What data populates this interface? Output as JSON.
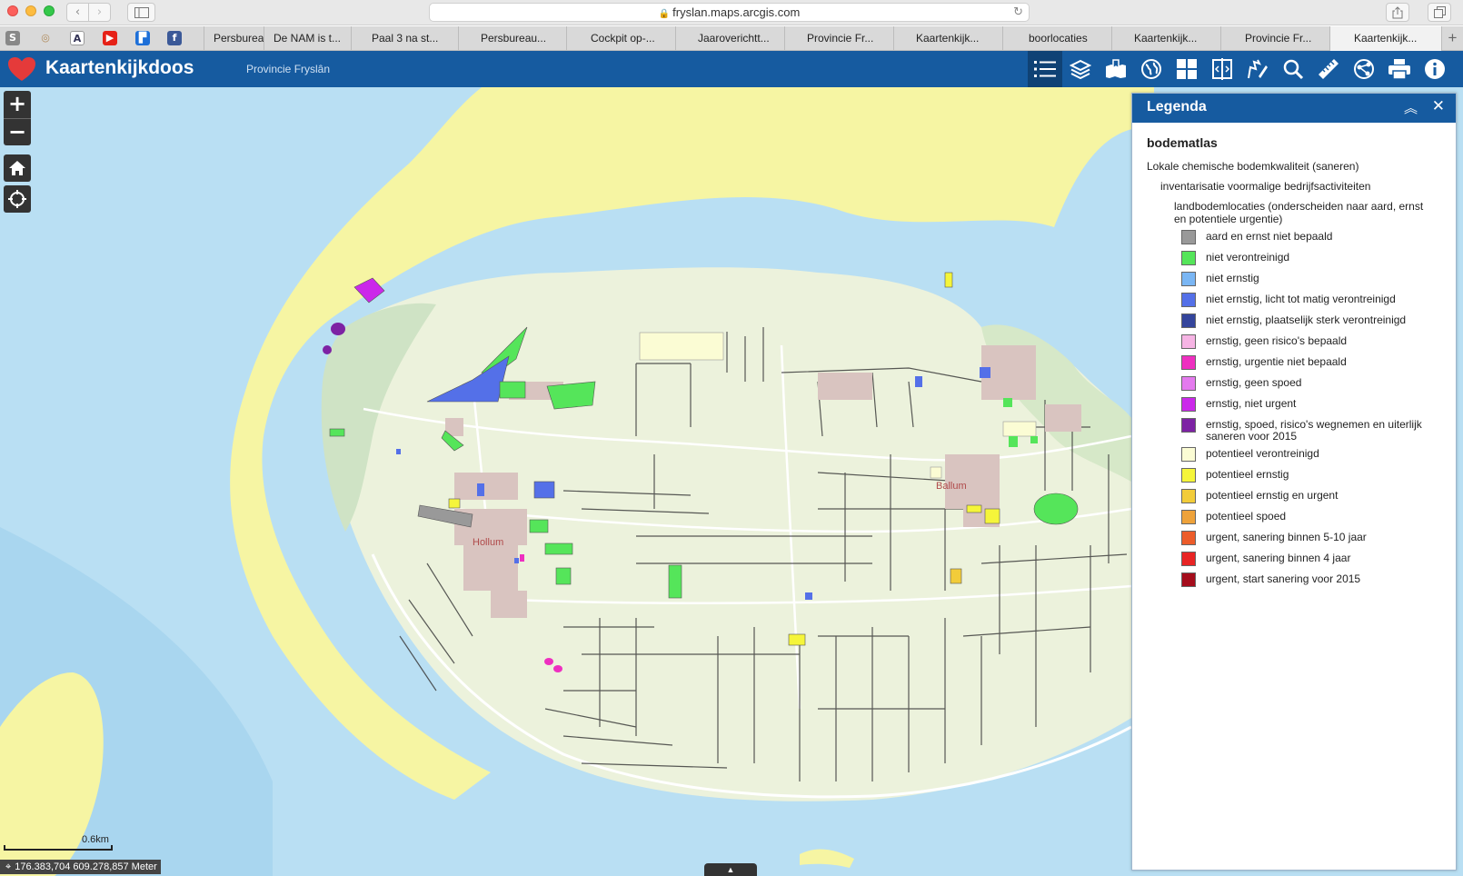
{
  "browser": {
    "url": "fryslan.maps.arcgis.com",
    "tabs": [
      {
        "label": "Persbureau",
        "active": false
      },
      {
        "label": "De NAM is t...",
        "active": false
      },
      {
        "label": "Paal 3 na st...",
        "active": false
      },
      {
        "label": "Persbureau...",
        "active": false
      },
      {
        "label": "Cockpit op-...",
        "active": false
      },
      {
        "label": "Jaaroverichtt...",
        "active": false
      },
      {
        "label": "Provincie Fr...",
        "active": false
      },
      {
        "label": "Kaartenkijk...",
        "active": false
      },
      {
        "label": "boorlocaties",
        "active": false
      },
      {
        "label": "Kaartenkijk...",
        "active": false
      },
      {
        "label": "Provincie Fr...",
        "active": false
      },
      {
        "label": "Kaartenkijk...",
        "active": true
      }
    ],
    "new_tab": "+"
  },
  "app": {
    "title": "Kaartenkijkdoos",
    "subtitle": "Provincie Fryslân",
    "brand_color": "#165ba0",
    "toolbar": [
      "list-icon",
      "layers-icon",
      "bookmark-icon",
      "globe-icon",
      "grid-icon",
      "swipe-icon",
      "draw-icon",
      "search-icon",
      "measure-icon",
      "share-icon",
      "print-icon",
      "info-icon"
    ]
  },
  "map": {
    "zoom_in": "+",
    "zoom_out": "−",
    "place_labels": [
      "Hollum",
      "Ballum"
    ],
    "scale_label": "0.6km",
    "coordinates": "176.383,704 609.278,857 Meter",
    "expander": "▲"
  },
  "legend": {
    "title": "Legenda",
    "collapse": "︽",
    "close": "✕",
    "layer": "bodematlas",
    "group1": "Lokale chemische bodemkwaliteit (saneren)",
    "group2": "inventarisatie voormalige bedrijfsactiviteiten",
    "group3": "landbodemlocaties (onderscheiden naar aard, ernst en potentiele urgentie)",
    "items": [
      {
        "label": "aard en ernst niet bepaald",
        "color": "#999999"
      },
      {
        "label": "niet verontreinigd",
        "color": "#55e55a"
      },
      {
        "label": "niet ernstig",
        "color": "#7ab6f4"
      },
      {
        "label": "niet ernstig, licht tot matig verontreinigd",
        "color": "#5470e8"
      },
      {
        "label": "niet ernstig, plaatselijk sterk verontreinigd",
        "color": "#34459c"
      },
      {
        "label": "ernstig, geen risico's bepaald",
        "color": "#f6b4e4"
      },
      {
        "label": "ernstig, urgentie niet bepaald",
        "color": "#ee2fc0"
      },
      {
        "label": "ernstig, geen spoed",
        "color": "#e47aee"
      },
      {
        "label": "ernstig, niet urgent",
        "color": "#cb28ea"
      },
      {
        "label": "ernstig, spoed, risico's wegnemen en uiterlijk saneren voor 2015",
        "color": "#7d22a4"
      },
      {
        "label": "potentieel verontreinigd",
        "color": "#fbfcd4"
      },
      {
        "label": "potentieel ernstig",
        "color": "#f5f53a"
      },
      {
        "label": "potentieel ernstig en urgent",
        "color": "#f2cc3a"
      },
      {
        "label": "potentieel spoed",
        "color": "#eea23a"
      },
      {
        "label": "urgent, sanering binnen 5-10 jaar",
        "color": "#ec5c2a"
      },
      {
        "label": "urgent, sanering binnen 4 jaar",
        "color": "#e82424"
      },
      {
        "label": "urgent, start sanering voor 2015",
        "color": "#a50d1c"
      }
    ]
  }
}
